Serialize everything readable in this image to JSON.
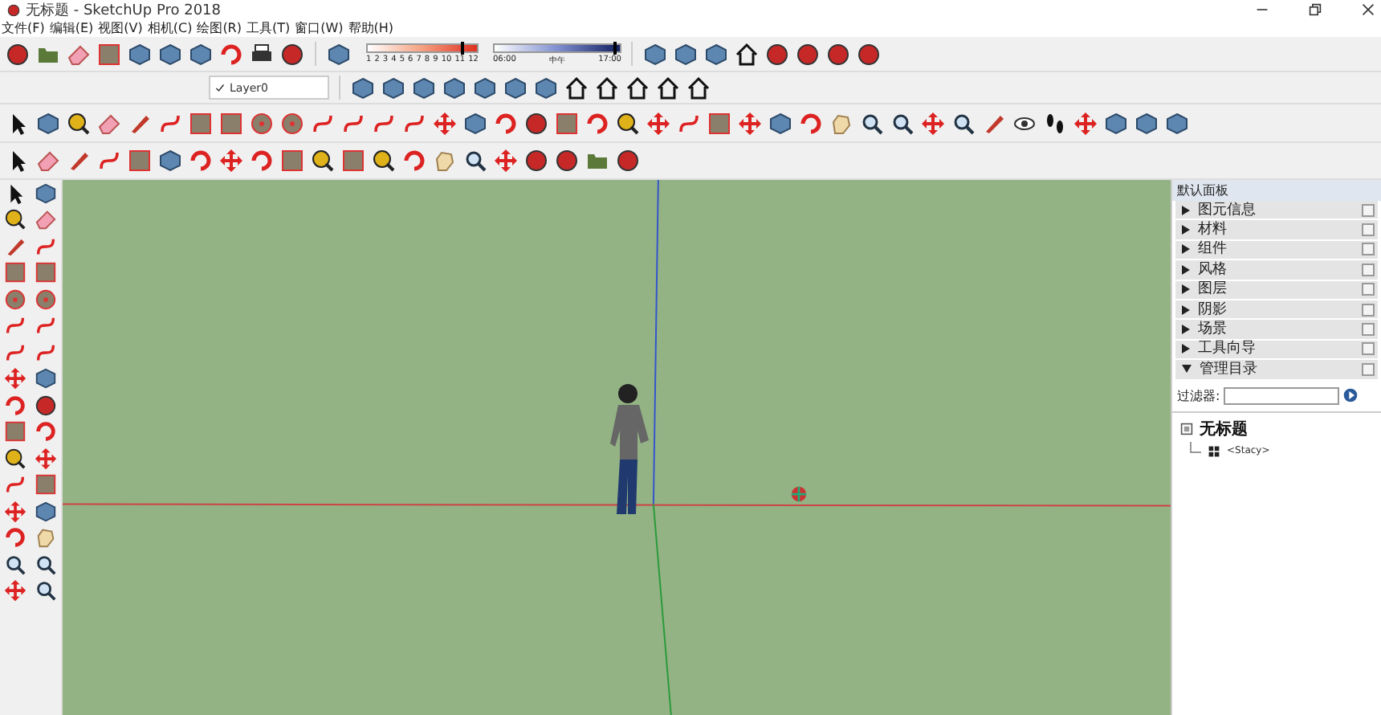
{
  "window": {
    "title": "无标题 - SketchUp Pro 2018"
  },
  "menu": [
    "文件(F)",
    "编辑(E)",
    "视图(V)",
    "相机(C)",
    "绘图(R)",
    "工具(T)",
    "窗口(W)",
    "帮助(H)"
  ],
  "shadow_toolbar": {
    "months": [
      "1",
      "2",
      "3",
      "4",
      "5",
      "6",
      "7",
      "8",
      "9",
      "10",
      "11",
      "12"
    ],
    "month_slider": {
      "level": 0.86
    },
    "time_labels": [
      "06:00",
      "中午",
      "17:00"
    ],
    "time_slider": {
      "level": 0.95
    }
  },
  "layer_toolbar": {
    "layer": "Layer0"
  },
  "tray": {
    "title": "默认面板",
    "sections": [
      {
        "label": "图元信息",
        "expanded": false
      },
      {
        "label": "材料",
        "expanded": false
      },
      {
        "label": "组件",
        "expanded": false
      },
      {
        "label": "风格",
        "expanded": false
      },
      {
        "label": "图层",
        "expanded": false
      },
      {
        "label": "阴影",
        "expanded": false
      },
      {
        "label": "场景",
        "expanded": false
      },
      {
        "label": "工具向导",
        "expanded": false
      },
      {
        "label": "管理目录",
        "expanded": true
      }
    ],
    "filter_label": "过滤器:",
    "outliner": [
      {
        "label": "无标题",
        "children": [
          {
            "label": "<Stacy>"
          }
        ]
      }
    ]
  }
}
